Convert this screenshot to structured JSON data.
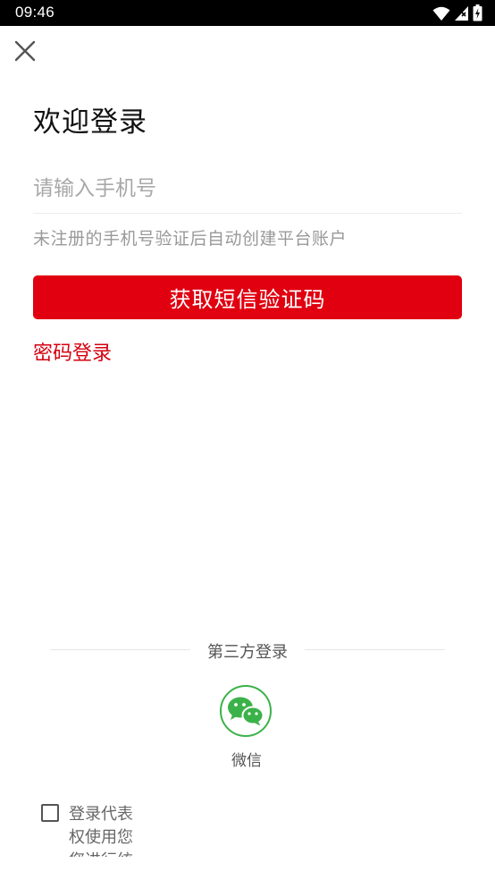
{
  "status_bar": {
    "time": "09:46"
  },
  "login": {
    "title": "欢迎登录",
    "phone_placeholder": "请输入手机号",
    "hint": "未注册的手机号验证后自动创建平台账户",
    "sms_button": "获取短信验证码",
    "password_login": "密码登录"
  },
  "third_party": {
    "label": "第三方登录",
    "wechat_label": "微信"
  },
  "agreement": {
    "line1": "登录代表",
    "line2": "权使用您",
    "line3": "您进行统"
  },
  "colors": {
    "accent": "#e00010",
    "wechat": "#3bb249"
  }
}
